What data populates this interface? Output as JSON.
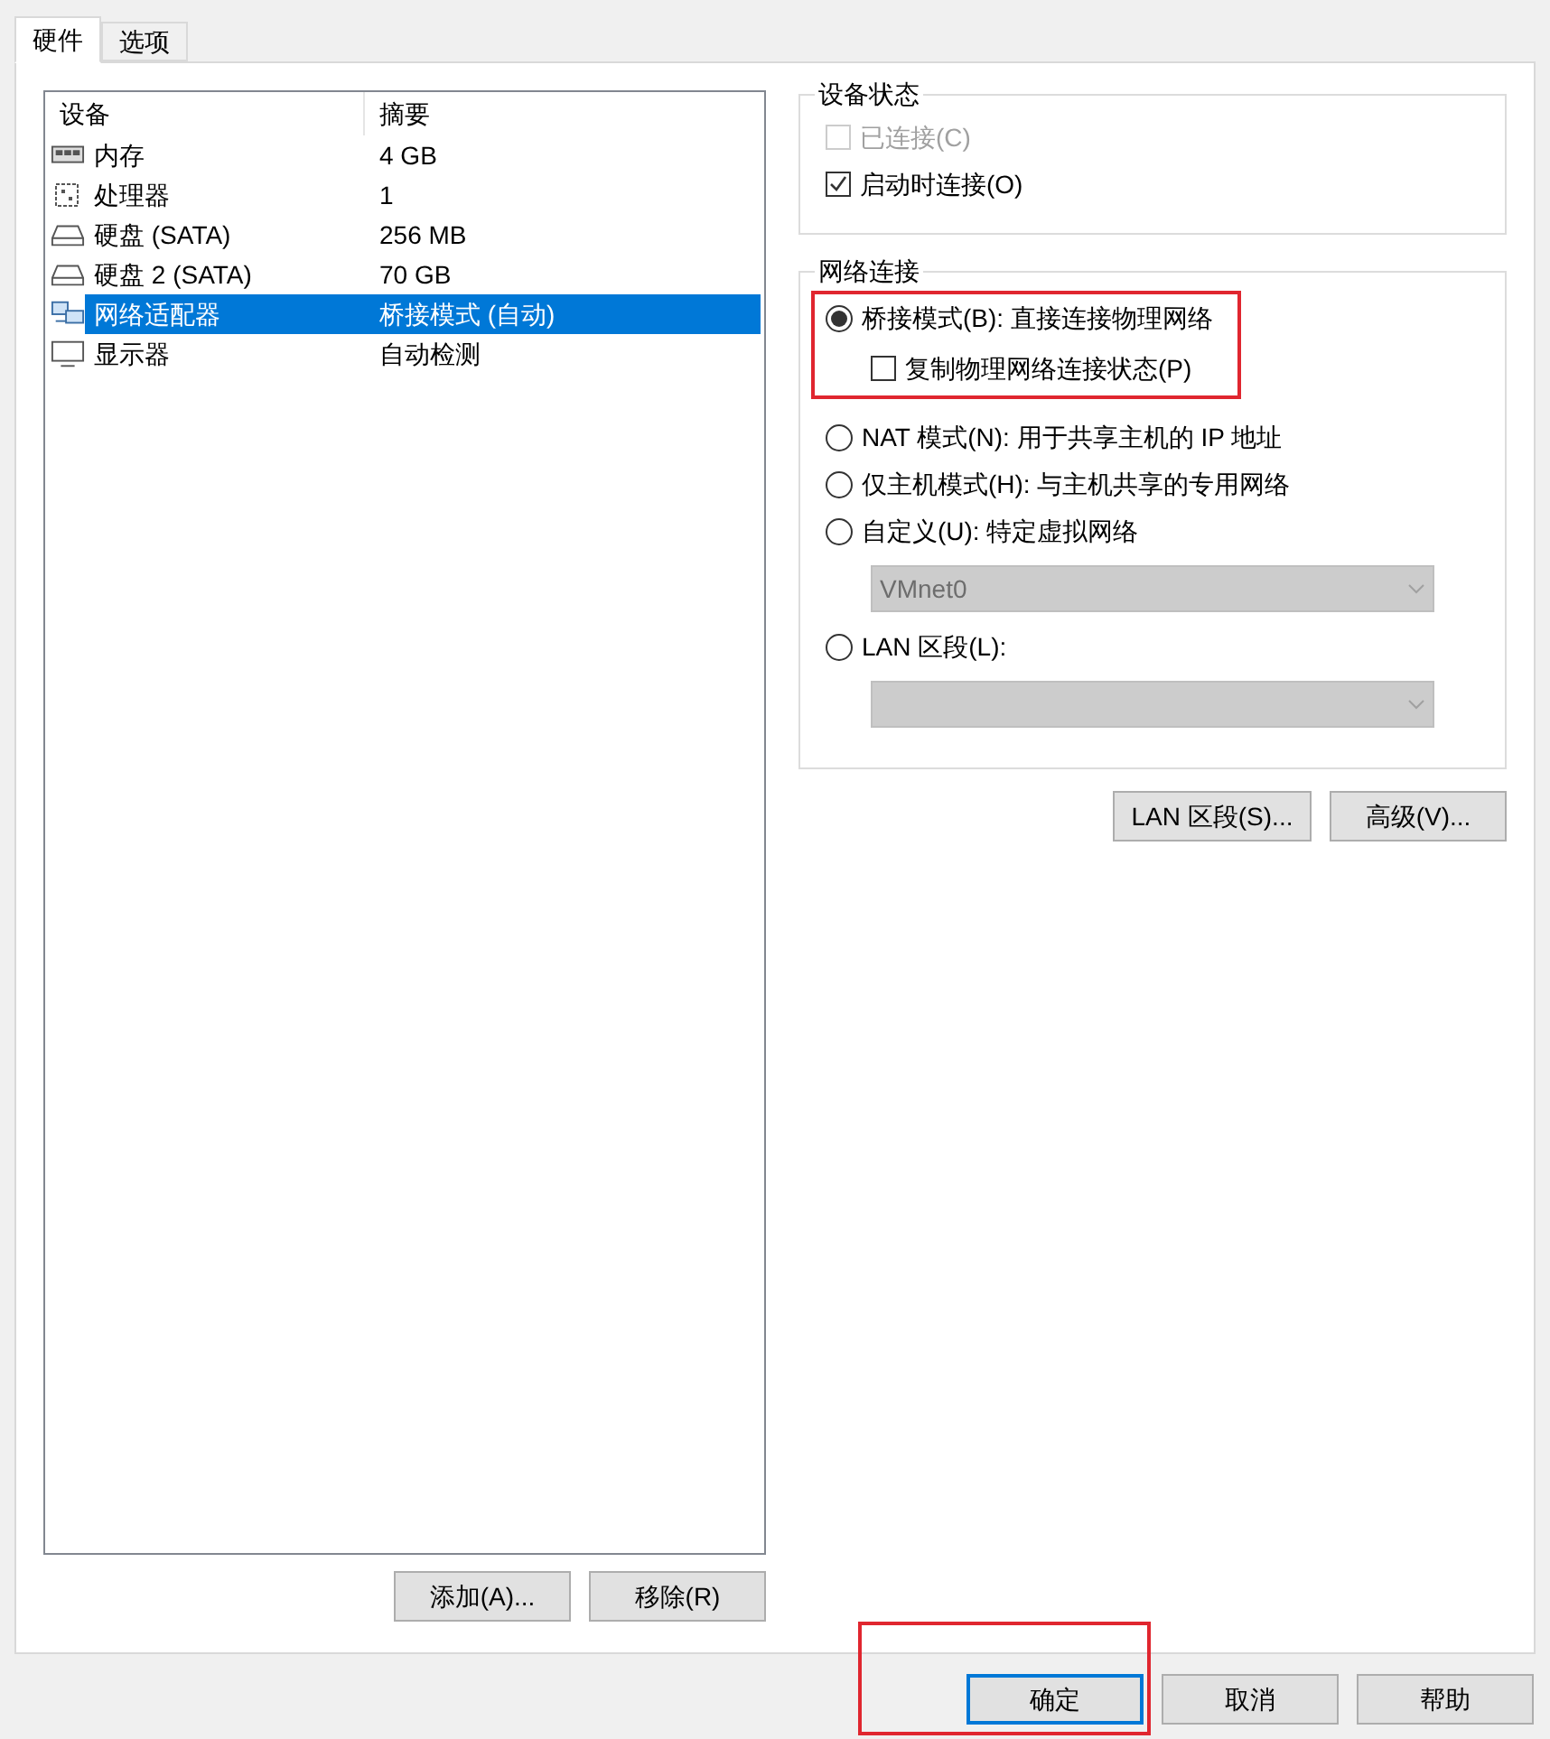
{
  "tabs": [
    {
      "label": "硬件",
      "selected": true
    },
    {
      "label": "选项",
      "selected": false
    }
  ],
  "devices": {
    "columns": [
      "设备",
      "摘要"
    ],
    "rows": [
      {
        "kind": "memory",
        "name": "内存",
        "summary": "4 GB",
        "selected": false
      },
      {
        "kind": "cpu",
        "name": "处理器",
        "summary": "1",
        "selected": false
      },
      {
        "kind": "disk",
        "name": "硬盘 (SATA)",
        "summary": "256 MB",
        "selected": false
      },
      {
        "kind": "disk",
        "name": "硬盘 2 (SATA)",
        "summary": "70 GB",
        "selected": false
      },
      {
        "kind": "network",
        "name": "网络适配器",
        "summary": "桥接模式 (自动)",
        "selected": true
      },
      {
        "kind": "display",
        "name": "显示器",
        "summary": "自动检测",
        "selected": false
      }
    ],
    "buttons": [
      "添加(A)...",
      "移除(R)"
    ]
  },
  "device_status": {
    "title": "设备状态",
    "items": [
      {
        "label": "已连接(C)",
        "checked": false,
        "disabled": true
      },
      {
        "label": "启动时连接(O)",
        "checked": true,
        "disabled": false
      }
    ]
  },
  "network_connection": {
    "title": "网络连接",
    "items": [
      {
        "kind": "radio",
        "label": "桥接模式(B): 直接连接物理网络",
        "selected": true,
        "highlighted": true
      },
      {
        "kind": "checkbox",
        "label": "复制物理网络连接状态(P)",
        "checked": false,
        "highlighted": true
      },
      {
        "kind": "radio",
        "label": "NAT 模式(N): 用于共享主机的 IP 地址",
        "selected": false
      },
      {
        "kind": "radio",
        "label": "仅主机模式(H): 与主机共享的专用网络",
        "selected": false
      },
      {
        "kind": "radio",
        "label": "自定义(U): 特定虚拟网络",
        "selected": false
      },
      {
        "kind": "select",
        "value": "VMnet0",
        "disabled": true
      },
      {
        "kind": "radio",
        "label": "LAN 区段(L):",
        "selected": false
      },
      {
        "kind": "select",
        "disabled": true
      }
    ],
    "buttons": [
      "LAN 区段(S)...",
      "高级(V)..."
    ]
  },
  "footer_buttons": [
    {
      "label": "确定",
      "default": true
    },
    {
      "label": "取消",
      "default": false
    },
    {
      "label": "帮助",
      "default": false
    }
  ]
}
